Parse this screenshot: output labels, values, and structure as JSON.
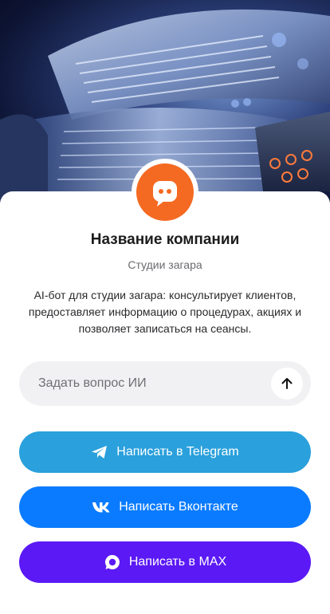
{
  "company": {
    "name": "Название компании",
    "category": "Студии загара",
    "description": "AI-бот для студии загара: консультирует клиентов, предоставляет информацию о процедурах, акциях и позволяет записаться на сеансы."
  },
  "ask": {
    "placeholder": "Задать вопрос ИИ",
    "value": ""
  },
  "buttons": {
    "telegram": "Написать в Telegram",
    "vk": "Написать Вконтакте",
    "max": "Написать в MAX"
  },
  "icons": {
    "avatar": "chat-bot-icon",
    "send": "arrow-up-icon",
    "telegram": "telegram-icon",
    "vk": "vk-icon",
    "max": "max-icon"
  },
  "colors": {
    "avatar": "#f56a22",
    "telegram": "#2aa0dc",
    "vk": "#0a7bff",
    "max": "#5b19f5"
  }
}
